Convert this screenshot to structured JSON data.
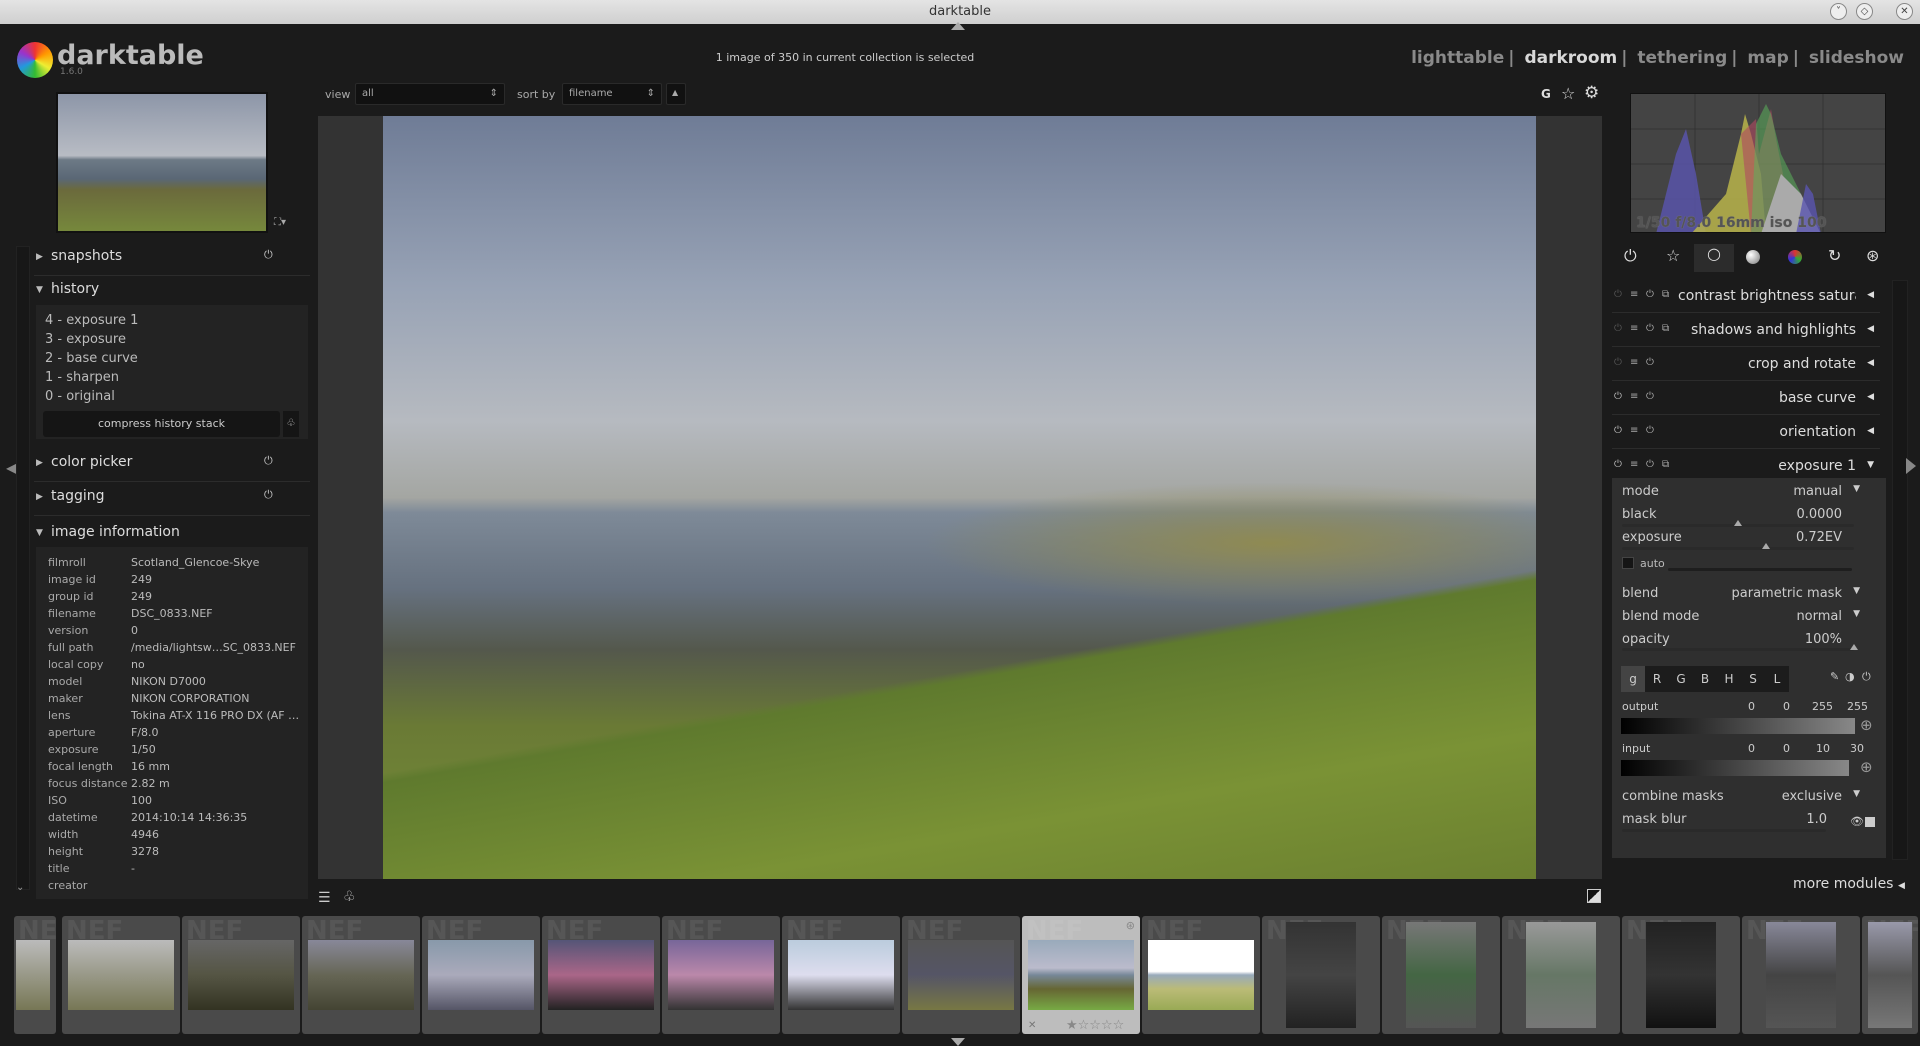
{
  "window": {
    "title": "darktable"
  },
  "app": {
    "name": "darktable",
    "version": "1.6.0"
  },
  "header": {
    "status": "1 image of 350 in current collection is selected",
    "views": [
      "lighttable",
      "darkroom",
      "tethering",
      "map",
      "slideshow"
    ],
    "active_view": "darkroom",
    "separator": "|"
  },
  "toolbar": {
    "view_label": "view",
    "view_value": "all",
    "sort_label": "sort by",
    "sort_value": "filename",
    "sort_dir": "▲",
    "grouping": "G"
  },
  "left": {
    "snapshots": "snapshots",
    "history": "history",
    "history_items": [
      "4 - exposure 1",
      "3 - exposure",
      "2 - base curve",
      "1 - sharpen",
      "0 - original"
    ],
    "compress": "compress history stack",
    "color_picker": "color picker",
    "tagging": "tagging",
    "image_information": "image information",
    "info": [
      {
        "k": "filmroll",
        "v": "Scotland_Glencoe-Skye"
      },
      {
        "k": "image id",
        "v": "249"
      },
      {
        "k": "group id",
        "v": "249"
      },
      {
        "k": "filename",
        "v": "DSC_0833.NEF"
      },
      {
        "k": "version",
        "v": "0"
      },
      {
        "k": "full path",
        "v": "/media/lightsw…SC_0833.NEF"
      },
      {
        "k": "local copy",
        "v": "no"
      },
      {
        "k": "model",
        "v": "NIKON D7000"
      },
      {
        "k": "maker",
        "v": "NIKON CORPORATION"
      },
      {
        "k": "lens",
        "v": "Tokina AT-X 116 PRO DX (AF …"
      },
      {
        "k": "aperture",
        "v": "F/8.0"
      },
      {
        "k": "exposure",
        "v": "1/50"
      },
      {
        "k": "focal length",
        "v": "16 mm"
      },
      {
        "k": "focus distance",
        "v": "2.82 m"
      },
      {
        "k": "ISO",
        "v": "100"
      },
      {
        "k": "datetime",
        "v": "2014:10:14 14:36:35"
      },
      {
        "k": "width",
        "v": "4946"
      },
      {
        "k": "height",
        "v": "3278"
      },
      {
        "k": "title",
        "v": "-"
      },
      {
        "k": "creator",
        "v": ""
      }
    ]
  },
  "right": {
    "histogram_info": "1/50 f/8.0 16mm iso 100",
    "modules": [
      "contrast brightness saturation",
      "shadows and highlights",
      "crop and rotate",
      "base curve",
      "orientation",
      "exposure 1"
    ],
    "exposure": {
      "mode_label": "mode",
      "mode": "manual",
      "black_label": "black",
      "black": "0.0000",
      "black_level": 0.5,
      "exposure_label": "exposure",
      "exposure": "0.72EV",
      "exposure_level": 0.62,
      "auto_label": "auto",
      "blend_label": "blend",
      "blend": "parametric mask",
      "blend_mode_label": "blend mode",
      "blend_mode": "normal",
      "opacity_label": "opacity",
      "opacity": "100%",
      "opacity_level": 1.0,
      "channels": [
        "g",
        "R",
        "G",
        "B",
        "H",
        "S",
        "L"
      ],
      "active_channel": "g",
      "output_label": "output",
      "output_values": [
        "0",
        "0",
        "255",
        "255"
      ],
      "input_label": "input",
      "input_values": [
        "0",
        "0",
        "10",
        "30"
      ],
      "combine_label": "combine masks",
      "combine": "exclusive",
      "mask_blur_label": "mask blur",
      "mask_blur": "1.0"
    },
    "more_modules": "more modules"
  },
  "filmstrip": {
    "watermark": "NEF",
    "selected_rating": 1,
    "max_rating": 5
  }
}
